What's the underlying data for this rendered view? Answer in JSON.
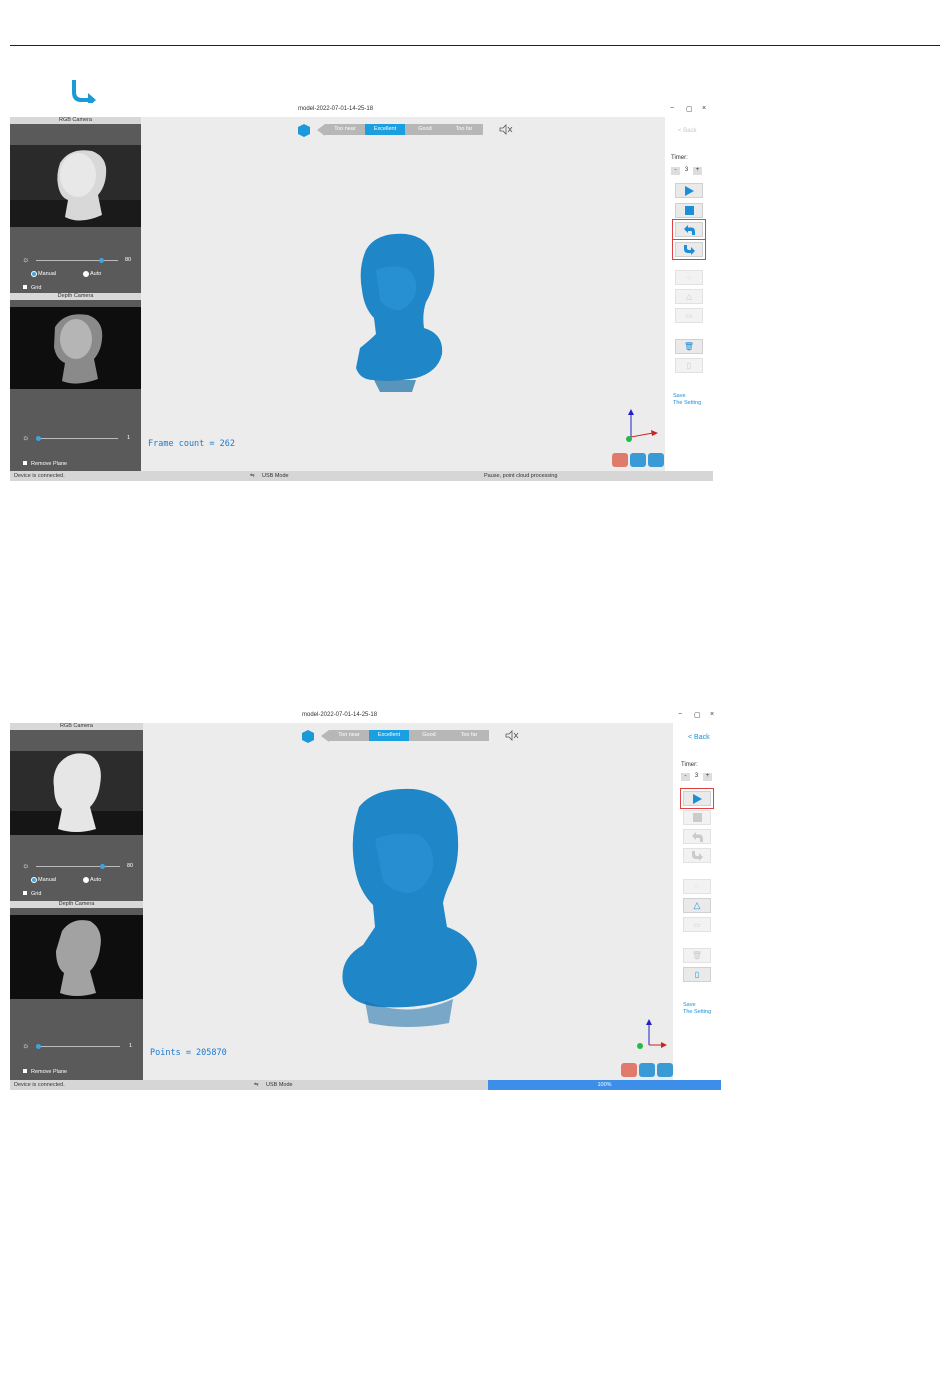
{
  "shot1": {
    "title": "model-2022-07-01-14-25-18",
    "back": "< Back",
    "timer_label": "Timer:",
    "timer_minus": "-",
    "timer_value": "3",
    "timer_plus": "+",
    "quality": [
      "Too near",
      "Excellent",
      "Good",
      "Too far"
    ],
    "rgb_camera": "RGB Camera",
    "depth_camera": "Depth Camera",
    "exposure_value": "80",
    "manual": "Manual",
    "auto": "Auto",
    "grid": "Grid",
    "depth_value": "1",
    "remove_plane": "Remove Plane",
    "counter": "Frame count = 262",
    "save_setting_1": "Save",
    "save_setting_2": "The Setting",
    "status_left": "Device is connected.",
    "status_mid": "USB Mode",
    "status_right": "Pause, point cloud processing"
  },
  "shot2": {
    "title": "model-2022-07-01-14-25-18",
    "back": "< Back",
    "timer_label": "Timer:",
    "timer_minus": "-",
    "timer_value": "3",
    "timer_plus": "+",
    "quality": [
      "Too near",
      "Excellent",
      "Good",
      "Too far"
    ],
    "rgb_camera": "RGB Camera",
    "depth_camera": "Depth Camera",
    "exposure_value": "80",
    "manual": "Manual",
    "auto": "Auto",
    "grid": "Grid",
    "depth_value": "1",
    "remove_plane": "Remove Plane",
    "counter": "Points = 205870",
    "save_setting_1": "Save",
    "save_setting_2": "The Setting",
    "status_left": "Device is connected.",
    "status_mid": "USB Mode",
    "progress": "100%"
  },
  "colors": {
    "accent": "#1aa0e0",
    "highlight": "#e04040",
    "model": "#1f86c7"
  }
}
